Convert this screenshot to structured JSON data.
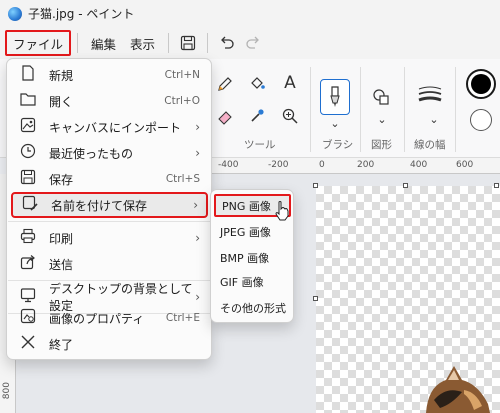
{
  "titlebar": {
    "title": "子猫.jpg - ペイント",
    "app_icon": "paint-app-icon"
  },
  "menubar": {
    "file": "ファイル",
    "edit": "編集",
    "view": "表示",
    "save_icon": "save-icon",
    "undo_icon": "undo-icon",
    "redo_icon": "redo-icon"
  },
  "ribbon": {
    "tools_label": "ツール",
    "brush_label": "ブラシ",
    "shapes_label": "図形",
    "line_width_label": "線の幅",
    "text_tool_glyph": "A",
    "primary_color": "#000000",
    "secondary_color": "#ffffff",
    "accent_color": "#1f6fd0"
  },
  "ruler": {
    "h_ticks": [
      "-400",
      "-200",
      "0",
      "200",
      "400",
      "600"
    ],
    "v_ticks": [
      "800"
    ]
  },
  "file_menu": {
    "items": [
      {
        "label": "新規",
        "shortcut": "Ctrl+N",
        "icon": "new-file-icon"
      },
      {
        "label": "開く",
        "shortcut": "Ctrl+O",
        "icon": "open-folder-icon"
      },
      {
        "label": "キャンバスにインポート",
        "shortcut": "",
        "icon": "import-image-icon",
        "submenu": true
      },
      {
        "label": "最近使ったもの",
        "shortcut": "",
        "icon": "clock-icon",
        "submenu": true
      },
      {
        "label": "保存",
        "shortcut": "Ctrl+S",
        "icon": "save-icon"
      },
      {
        "label": "名前を付けて保存",
        "shortcut": "",
        "icon": "save-as-icon",
        "submenu": true,
        "highlighted": true
      },
      {
        "label": "印刷",
        "shortcut": "",
        "icon": "print-icon",
        "submenu": true
      },
      {
        "label": "送信",
        "shortcut": "",
        "icon": "share-icon"
      },
      {
        "label": "デスクトップの背景として設定",
        "shortcut": "",
        "icon": "desktop-icon",
        "submenu": true
      },
      {
        "label": "画像のプロパティ",
        "shortcut": "Ctrl+E",
        "icon": "properties-icon"
      },
      {
        "label": "終了",
        "shortcut": "",
        "icon": "close-icon"
      }
    ]
  },
  "save_as_menu": {
    "items": [
      {
        "label": "PNG 画像",
        "highlighted": true
      },
      {
        "label": "JPEG 画像"
      },
      {
        "label": "BMP 画像"
      },
      {
        "label": "GIF 画像"
      },
      {
        "label": "その他の形式"
      }
    ]
  }
}
